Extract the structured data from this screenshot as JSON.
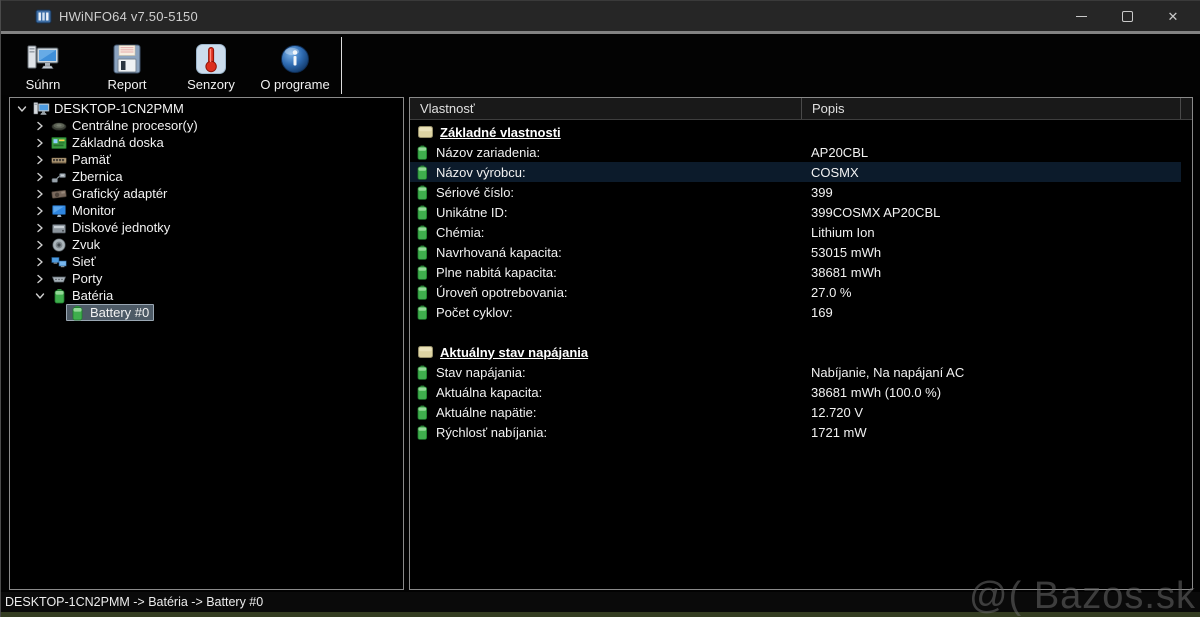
{
  "titlebar": {
    "title": "HWiNFO64 v7.50-5150"
  },
  "toolbar": {
    "buttons": [
      {
        "label": "Súhrn",
        "icon": "computer"
      },
      {
        "label": "Report",
        "icon": "floppy"
      },
      {
        "label": "Senzory",
        "icon": "thermometer"
      },
      {
        "label": "O programe",
        "icon": "info"
      }
    ]
  },
  "tree": {
    "items": [
      {
        "level": 0,
        "chevron": "expanded",
        "icon": "computer",
        "label": "DESKTOP-1CN2PMM",
        "selected": false
      },
      {
        "level": 1,
        "chevron": "collapsed",
        "icon": "cpu",
        "label": "Centrálne procesor(y)",
        "selected": false
      },
      {
        "level": 1,
        "chevron": "collapsed",
        "icon": "motherboard",
        "label": "Základná doska",
        "selected": false
      },
      {
        "level": 1,
        "chevron": "collapsed",
        "icon": "memory",
        "label": "Pamäť",
        "selected": false
      },
      {
        "level": 1,
        "chevron": "collapsed",
        "icon": "bus",
        "label": "Zbernica",
        "selected": false
      },
      {
        "level": 1,
        "chevron": "collapsed",
        "icon": "gpu",
        "label": "Grafický adaptér",
        "selected": false
      },
      {
        "level": 1,
        "chevron": "collapsed",
        "icon": "monitor",
        "label": "Monitor",
        "selected": false
      },
      {
        "level": 1,
        "chevron": "collapsed",
        "icon": "disk",
        "label": "Diskové jednotky",
        "selected": false
      },
      {
        "level": 1,
        "chevron": "collapsed",
        "icon": "audio",
        "label": "Zvuk",
        "selected": false
      },
      {
        "level": 1,
        "chevron": "collapsed",
        "icon": "network",
        "label": "Sieť",
        "selected": false
      },
      {
        "level": 1,
        "chevron": "collapsed",
        "icon": "ports",
        "label": "Porty",
        "selected": false
      },
      {
        "level": 1,
        "chevron": "expanded",
        "icon": "battery",
        "label": "Batéria",
        "selected": false
      },
      {
        "level": 2,
        "chevron": "none",
        "icon": "battery",
        "label": "Battery #0",
        "selected": true
      }
    ]
  },
  "properties": {
    "columns": [
      "Vlastnosť",
      "Popis"
    ],
    "sections": [
      {
        "title": "Základné vlastnosti",
        "icon": "folder",
        "rows": [
          {
            "label": "Názov zariadenia:",
            "value": "AP20CBL",
            "selected": false
          },
          {
            "label": "Názov výrobcu:",
            "value": "COSMX",
            "selected": true
          },
          {
            "label": "Sériové číslo:",
            "value": "399",
            "selected": false
          },
          {
            "label": "Unikátne ID:",
            "value": "399COSMX AP20CBL",
            "selected": false
          },
          {
            "label": "Chémia:",
            "value": "Lithium Ion",
            "selected": false
          },
          {
            "label": "Navrhovaná kapacita:",
            "value": "53015 mWh",
            "selected": false
          },
          {
            "label": "Plne nabitá kapacita:",
            "value": "38681 mWh",
            "selected": false
          },
          {
            "label": "Úroveň opotrebovania:",
            "value": "27.0 %",
            "selected": false
          },
          {
            "label": "Počet cyklov:",
            "value": "169",
            "selected": false
          }
        ]
      },
      {
        "title": "Aktuálny stav napájania",
        "icon": "folder",
        "rows": [
          {
            "label": "Stav napájania:",
            "value": "Nabíjanie, Na napájaní AC",
            "selected": false
          },
          {
            "label": "Aktuálna kapacita:",
            "value": "38681 mWh (100.0 %)",
            "selected": false
          },
          {
            "label": "Aktuálne napätie:",
            "value": "12.720 V",
            "selected": false
          },
          {
            "label": "Rýchlosť nabíjania:",
            "value": "1721 mW",
            "selected": false
          }
        ]
      }
    ]
  },
  "statusbar": {
    "path": "DESKTOP-1CN2PMM -> Batéria -> Battery #0"
  },
  "watermark": {
    "text": "@( Bazos.sk"
  },
  "colors": {
    "battery_green": "#3fae4d",
    "folder_tan": "#ddd3a2",
    "selected_row_blue": "#0c1b2b",
    "tree_selection_gray": "#4d5a66",
    "thermometer_red": "#dc2f1e",
    "info_blue": "#2f6cb3",
    "titlebar_gray": "#262626"
  }
}
